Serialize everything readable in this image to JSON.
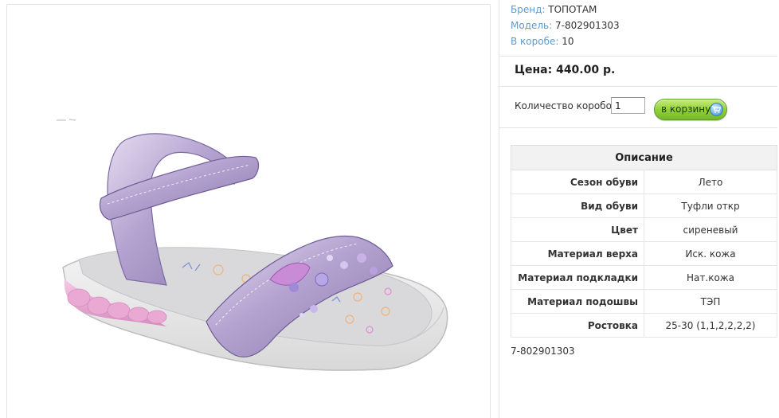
{
  "product": {
    "image_alt": "product-photo-lilac-sandal"
  },
  "attributes": [
    {
      "label": "Бренд:",
      "value": "ТОПОТАМ"
    },
    {
      "label": "Модель:",
      "value": "7-802901303"
    },
    {
      "label": "В коробе:",
      "value": "10"
    }
  ],
  "price": {
    "text": "Цена: 440.00 р."
  },
  "order": {
    "qty_label": "Количество коробов:",
    "qty_value": "1",
    "cart_button_label": "в корзину",
    "cart_icon": "cart-icon"
  },
  "description": {
    "header": "Описание",
    "rows": [
      {
        "key": "Сезон обуви",
        "value": "Лето"
      },
      {
        "key": "Вид обуви",
        "value": "Туфли откр"
      },
      {
        "key": "Цвет",
        "value": "сиреневый"
      },
      {
        "key": "Материал верха",
        "value": "Иск. кожа"
      },
      {
        "key": "Материал подкладки",
        "value": "Нат.кожа"
      },
      {
        "key": "Материал подошвы",
        "value": "ТЭП"
      },
      {
        "key": "Ростовка",
        "value": "25-30 (1,1,2,2,2,2)"
      }
    ]
  },
  "footer": {
    "sku": "7-802901303"
  },
  "colors": {
    "attr_label": "#5a9bd5",
    "cart_button": "#93d23a",
    "sandal_strap": "#b9a8d4",
    "sole_pink": "#e7a3cf"
  }
}
